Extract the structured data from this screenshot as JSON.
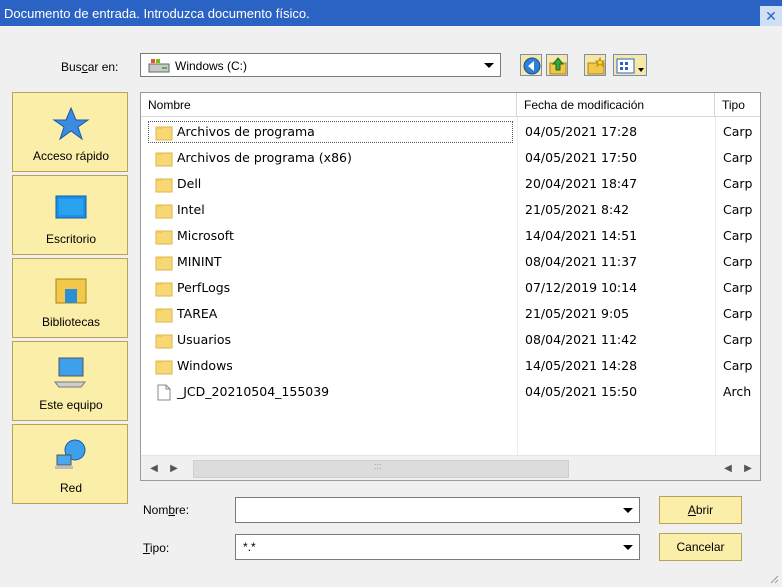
{
  "window": {
    "title": "Documento de entrada. Introduzca documento físico.",
    "close_glyph": "✕"
  },
  "lookin": {
    "label_pre": "Bus",
    "label_accel": "c",
    "label_post": "ar en:",
    "value": "Windows (C:)",
    "icon": "drive-icon"
  },
  "toolbar": [
    {
      "name": "back-button",
      "icon": "back-icon"
    },
    {
      "name": "up-folder-button",
      "icon": "up-folder-icon"
    },
    {
      "name": "new-folder-button",
      "icon": "new-folder-icon"
    },
    {
      "name": "view-menu-button",
      "icon": "view-menu-icon"
    }
  ],
  "places": [
    {
      "label": "Acceso rápido",
      "icon": "star-icon"
    },
    {
      "label": "Escritorio",
      "icon": "desktop-icon"
    },
    {
      "label": "Bibliotecas",
      "icon": "libraries-icon"
    },
    {
      "label": "Este equipo",
      "icon": "computer-icon"
    },
    {
      "label": "Red",
      "icon": "network-icon"
    }
  ],
  "columns": {
    "name": "Nombre",
    "date": "Fecha de modificación",
    "type": "Tipo"
  },
  "files": [
    {
      "name": "Archivos de programa",
      "date": "04/05/2021 17:28",
      "type": "Carp",
      "kind": "folder"
    },
    {
      "name": "Archivos de programa (x86)",
      "date": "04/05/2021 17:50",
      "type": "Carp",
      "kind": "folder"
    },
    {
      "name": "Dell",
      "date": "20/04/2021 18:47",
      "type": "Carp",
      "kind": "folder"
    },
    {
      "name": "Intel",
      "date": "21/05/2021 8:42",
      "type": "Carp",
      "kind": "folder"
    },
    {
      "name": "Microsoft",
      "date": "14/04/2021 14:51",
      "type": "Carp",
      "kind": "folder"
    },
    {
      "name": "MININT",
      "date": "08/04/2021 11:37",
      "type": "Carp",
      "kind": "folder"
    },
    {
      "name": "PerfLogs",
      "date": "07/12/2019 10:14",
      "type": "Carp",
      "kind": "folder"
    },
    {
      "name": "TAREA",
      "date": "21/05/2021 9:05",
      "type": "Carp",
      "kind": "folder"
    },
    {
      "name": "Usuarios",
      "date": "08/04/2021 11:42",
      "type": "Carp",
      "kind": "folder"
    },
    {
      "name": "Windows",
      "date": "14/05/2021 14:28",
      "type": "Carp",
      "kind": "folder"
    },
    {
      "name": "_JCD_20210504_155039",
      "date": "04/05/2021 15:50",
      "type": "Arch",
      "kind": "file"
    }
  ],
  "scrollbar": {
    "left_glyph": "◀",
    "right_glyph": "▶",
    "grip": ":::"
  },
  "filename": {
    "label_pre": "Nom",
    "label_accel": "b",
    "label_post": "re:",
    "value": ""
  },
  "filetype": {
    "label_accel": "T",
    "label_post": "ipo:",
    "value": "*.*"
  },
  "buttons": {
    "open_accel": "A",
    "open_post": "brir",
    "cancel": "Cancelar"
  }
}
